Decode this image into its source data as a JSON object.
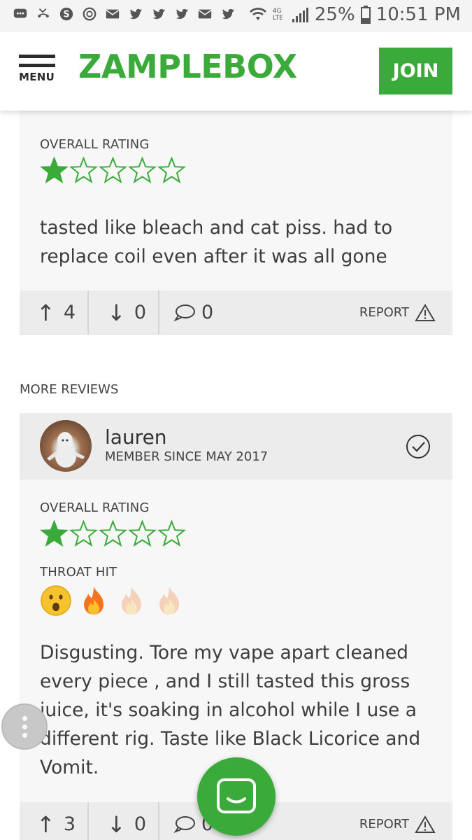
{
  "status_bar": {
    "battery": "25%",
    "time": "10:51 PM",
    "network": "4G LTE",
    "icons": [
      "chat-icon",
      "missed-call-icon",
      "skype-icon",
      "sync-icon",
      "mail-icon",
      "twitter-icon",
      "twitter-icon",
      "twitter-icon",
      "mail-icon",
      "twitter-icon",
      "wifi-icon",
      "signal-icon",
      "battery-icon"
    ]
  },
  "header": {
    "menu_label": "MENU",
    "logo": "ZAMPLEBOX",
    "join_label": "JOIN",
    "brand_color": "#3aab3a"
  },
  "review1": {
    "rating_label": "OVERALL RATING",
    "rating": 1,
    "max_rating": 5,
    "text": "tasted like bleach and cat piss. had to replace coil even after it was all gone",
    "upvotes": "4",
    "downvotes": "0",
    "comments": "0",
    "report_label": "REPORT"
  },
  "more_reviews_label": "MORE REVIEWS",
  "review2": {
    "username": "lauren",
    "member_since": "MEMBER SINCE MAY 2017",
    "rating_label": "OVERALL RATING",
    "rating": 1,
    "max_rating": 5,
    "throat_hit_label": "THROAT HIT",
    "throat_hit_level": 1,
    "throat_hit_max": 3,
    "text": "Disgusting. Tore my vape apart cleaned every piece , and I still tasted this gross juice, it's soaking in alcohol while I use a different rig. Taste like Black Licorice and Vomit.",
    "upvotes": "3",
    "downvotes": "0",
    "comments": "0",
    "report_label": "REPORT"
  }
}
